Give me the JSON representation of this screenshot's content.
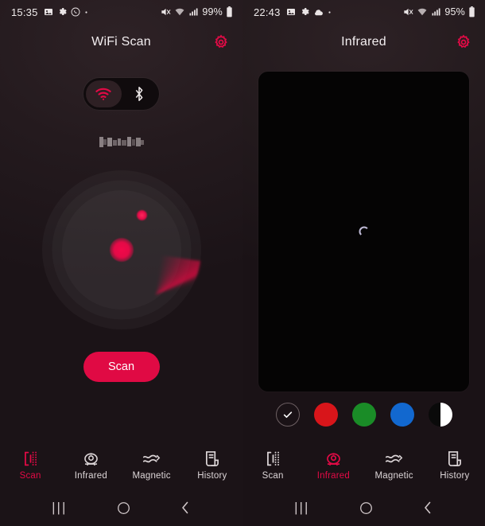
{
  "left": {
    "status": {
      "time": "15:35",
      "left_icons": [
        "image-icon",
        "gear-icon",
        "whatsapp-icon",
        "dot-icon"
      ],
      "right_icons": [
        "mute-icon",
        "wifi-icon",
        "signal-icon"
      ],
      "battery": "99%"
    },
    "appbar": {
      "title": "WiFi Scan",
      "settings_icon": "gear-icon"
    },
    "toggle": {
      "wifi_label": "wifi-icon",
      "bluetooth_label": "bluetooth-icon",
      "selected": "wifi"
    },
    "ssid": {
      "value": "",
      "censored": true
    },
    "radar": {
      "label": "radar-sweep"
    },
    "scan_button": {
      "label": "Scan"
    },
    "tabs": [
      {
        "label": "Scan",
        "icon": "scan-icon",
        "active": true
      },
      {
        "label": "Infrared",
        "icon": "camera-icon",
        "active": false
      },
      {
        "label": "Magnetic",
        "icon": "waves-icon",
        "active": false
      },
      {
        "label": "History",
        "icon": "document-icon",
        "active": false
      }
    ],
    "sysnav": {
      "recent": "|||",
      "home": "○",
      "back": "‹"
    }
  },
  "right": {
    "status": {
      "time": "22:43",
      "left_icons": [
        "image-icon",
        "gear-icon",
        "cloud-icon",
        "dot-icon"
      ],
      "right_icons": [
        "mute-icon",
        "wifi-icon",
        "signal-icon"
      ],
      "battery": "95%"
    },
    "appbar": {
      "title": "Infrared",
      "settings_icon": "gear-icon"
    },
    "preview": {
      "state": "loading",
      "spinner": "loading-spinner"
    },
    "filters": [
      {
        "name": "none",
        "icon": "check-icon",
        "color": "transparent",
        "selected": true
      },
      {
        "name": "red",
        "color": "#d8151a",
        "selected": false
      },
      {
        "name": "green",
        "color": "#1a8c27",
        "selected": false
      },
      {
        "name": "blue",
        "color": "#1268cf",
        "selected": false
      },
      {
        "name": "split",
        "color": "#0a0a0a",
        "selected": false
      }
    ],
    "tabs": [
      {
        "label": "Scan",
        "icon": "scan-icon",
        "active": false
      },
      {
        "label": "Infrared",
        "icon": "camera-icon",
        "active": true
      },
      {
        "label": "Magnetic",
        "icon": "waves-icon",
        "active": false
      },
      {
        "label": "History",
        "icon": "document-icon",
        "active": false
      }
    ],
    "sysnav": {
      "recent": "|||",
      "home": "○",
      "back": "‹"
    }
  },
  "theme": {
    "accent": "#e30a46",
    "background": "#241a1e",
    "text": "#f0ecec"
  }
}
